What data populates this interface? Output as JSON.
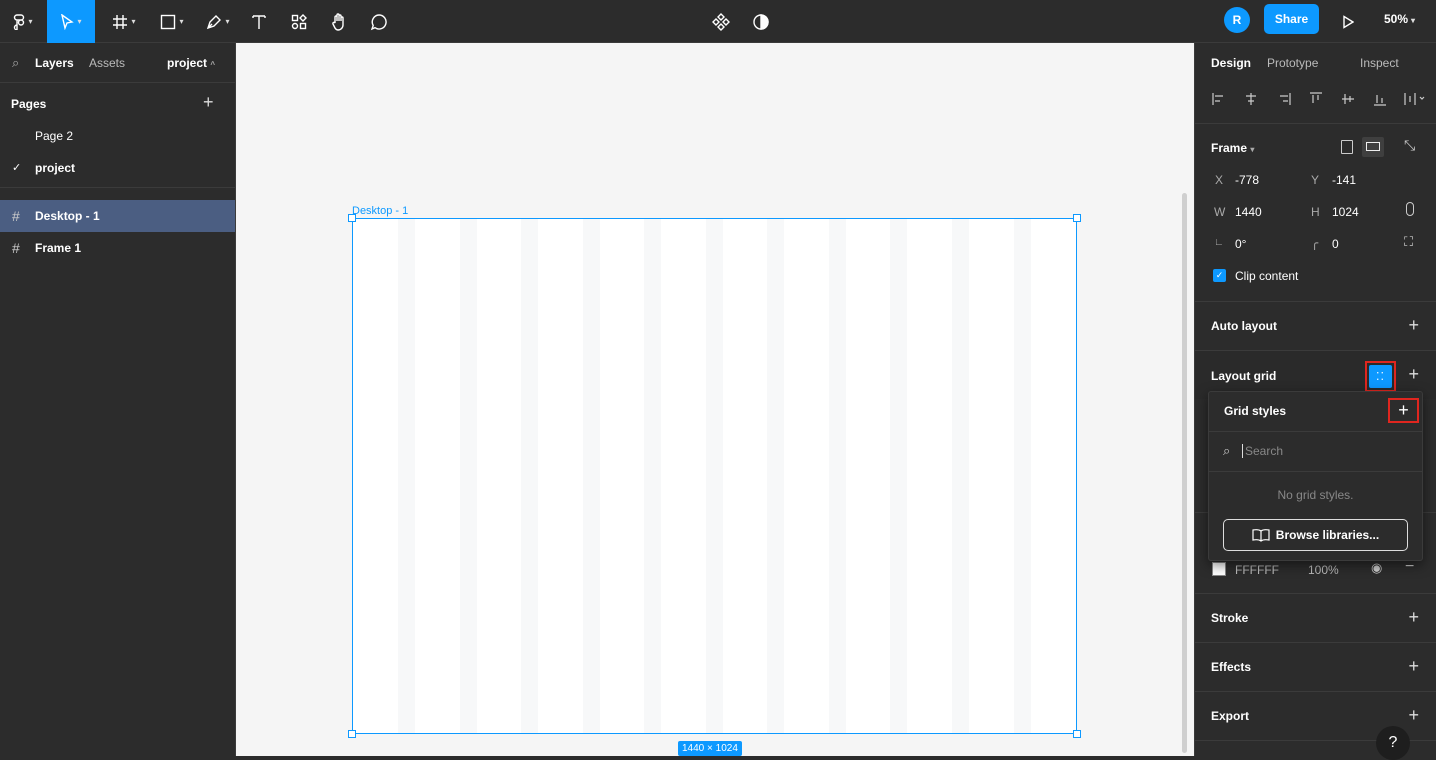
{
  "toolbar": {
    "zoom": "50%",
    "share_label": "Share",
    "avatar_initial": "R",
    "icons": [
      "figma-menu-icon",
      "move-tool-icon",
      "frame-tool-icon",
      "shape-tool-icon",
      "pen-tool-icon",
      "text-tool-icon",
      "resources-icon",
      "hand-tool-icon",
      "comment-icon",
      "components-icon",
      "theme-icon",
      "present-icon"
    ]
  },
  "left_panel": {
    "tabs": {
      "layers": "Layers",
      "assets": "Assets",
      "project": "project"
    },
    "pages_title": "Pages",
    "pages": [
      "Page 2",
      "project"
    ],
    "layers": [
      "Desktop - 1",
      "Frame 1"
    ]
  },
  "canvas": {
    "frame_label": "Desktop - 1",
    "size_badge": "1440 × 1024"
  },
  "right_panel": {
    "tabs": {
      "design": "Design",
      "prototype": "Prototype",
      "inspect": "Inspect"
    },
    "frame": {
      "title": "Frame",
      "x_label": "X",
      "x": "-778",
      "y_label": "Y",
      "y": "-141",
      "w_label": "W",
      "w": "1440",
      "h_label": "H",
      "h": "1024",
      "rotation": "0°",
      "radius": "0",
      "clip_content": "Clip content"
    },
    "auto_layout": "Auto layout",
    "layout_grid": "Layout grid",
    "fill": {
      "color": "FFFFFF",
      "opacity": "100%"
    },
    "stroke": "Stroke",
    "effects": "Effects",
    "export": "Export"
  },
  "grid_popover": {
    "title": "Grid styles",
    "search_placeholder": "Search",
    "empty_text": "No grid styles.",
    "browse_label": "Browse libraries..."
  },
  "help": "?",
  "colors": {
    "accent": "#0d99ff",
    "panel": "#2c2c2c",
    "canvas": "#f5f5f5",
    "highlight": "#e0261f"
  }
}
